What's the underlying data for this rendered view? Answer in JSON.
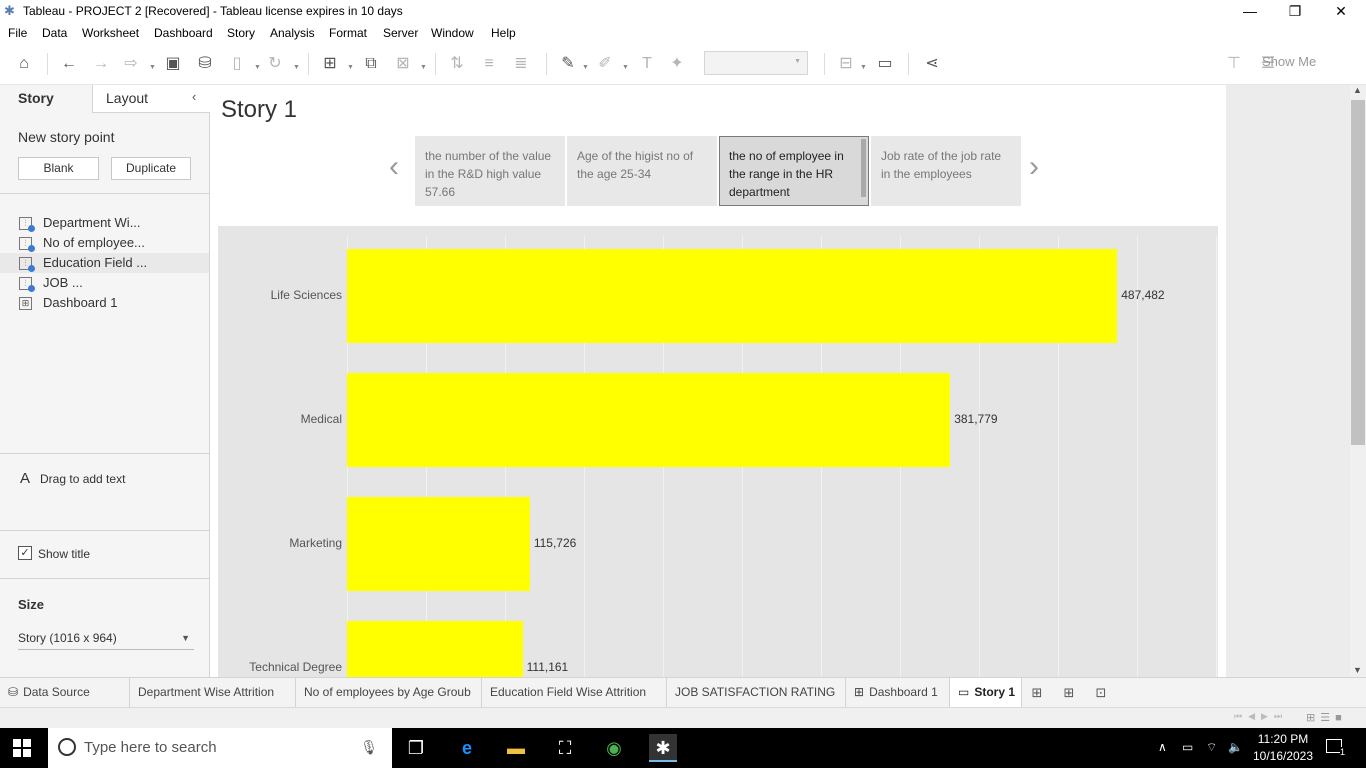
{
  "window": {
    "title": "Tableau - PROJECT 2 [Recovered] - Tableau license expires in 10 days",
    "minimize": "—",
    "restore": "❐",
    "close": "✕"
  },
  "menu": [
    "File",
    "Data",
    "Worksheet",
    "Dashboard",
    "Story",
    "Analysis",
    "Format",
    "Server",
    "Window",
    "Help"
  ],
  "toolbar": {
    "show_me": "Show Me",
    "icons": [
      "home-icon",
      "undo-icon",
      "redo-icon",
      "redo-dropdown-icon",
      "save-icon",
      "new-datasource-icon",
      "paste-icon",
      "refresh-icon",
      "new-worksheet-icon",
      "duplicate-icon",
      "clear-icon",
      "swap-icon",
      "sort-asc-icon",
      "sort-desc-icon",
      "highlight-icon",
      "attach-icon",
      "text-icon",
      "pin-icon",
      "fit-icon",
      "presentation-icon",
      "share-icon",
      "format-painter-icon",
      "show-me-icon"
    ]
  },
  "left_panel": {
    "tabs": [
      "Story",
      "Layout"
    ],
    "new_story_point": "New story point",
    "blank_btn": "Blank",
    "duplicate_btn": "Duplicate",
    "sheets": [
      {
        "label": "Department Wi...",
        "type": "worksheet"
      },
      {
        "label": "No of employee...",
        "type": "worksheet"
      },
      {
        "label": "Education Field ...",
        "type": "worksheet"
      },
      {
        "label": "JOB ...",
        "type": "worksheet"
      },
      {
        "label": "Dashboard 1",
        "type": "dashboard"
      }
    ],
    "drag_text": "Drag to add text",
    "drag_icon": "A",
    "show_title": "Show title",
    "show_title_checked": true,
    "size_heading": "Size",
    "size_value": "Story (1016 x 964)"
  },
  "story": {
    "title": "Story 1",
    "points": [
      {
        "text": "the  number of the value in the R&D high value 57.66",
        "active": false
      },
      {
        "text": "Age of the higist no of the age 25-34",
        "active": false
      },
      {
        "text": "the no of employee in the range in the HR department",
        "active": true
      },
      {
        "text": "Job rate of the  job rate in the employees",
        "active": false
      }
    ],
    "prev_arrow": "‹",
    "next_arrow": "›"
  },
  "chart_data": {
    "type": "bar",
    "orientation": "horizontal",
    "categories": [
      "Life Sciences",
      "Medical",
      "Marketing",
      "Technical Degree"
    ],
    "values": [
      487482,
      381779,
      115726,
      111161
    ],
    "labels": [
      "487,482",
      "381,779",
      "115,726",
      "111,161"
    ],
    "bar_color": "#ffff00",
    "xlim": [
      0,
      550000
    ],
    "grid": true,
    "title": "",
    "xlabel": "",
    "ylabel": ""
  },
  "sheet_tabs": [
    {
      "label": "Data Source",
      "icon": "datasource-icon",
      "glyph": "⛁",
      "active": false
    },
    {
      "label": "Department Wise Attrition",
      "icon": "",
      "glyph": "",
      "active": false
    },
    {
      "label": "No of employees by Age Groub",
      "icon": "",
      "glyph": "",
      "active": false
    },
    {
      "label": "Education Field Wise Attrition",
      "icon": "",
      "glyph": "",
      "active": false
    },
    {
      "label": "JOB SATISFACTION RATING",
      "icon": "",
      "glyph": "",
      "active": false
    },
    {
      "label": "Dashboard 1",
      "icon": "dashboard-icon",
      "glyph": "⊞",
      "active": false
    },
    {
      "label": "Story 1",
      "icon": "story-icon",
      "glyph": "▭",
      "active": true
    }
  ],
  "taskbar": {
    "search_placeholder": "Type here to search",
    "time": "11:20 PM",
    "date": "10/16/2023",
    "notification_count": "1"
  }
}
